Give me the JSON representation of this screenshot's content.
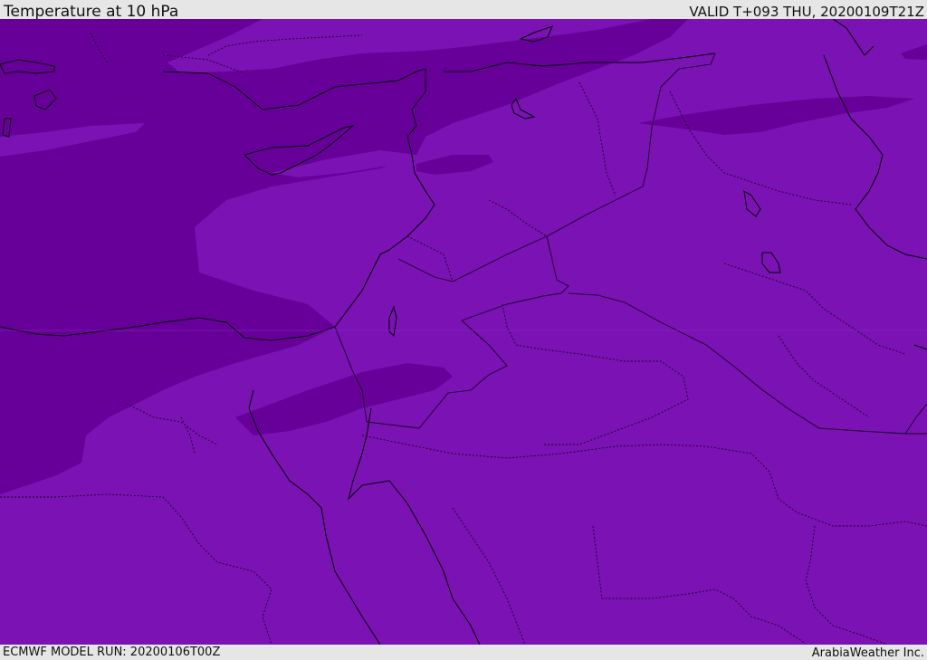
{
  "header": {
    "title": "Temperature at 10 hPa",
    "valid": "VALID T+093 THU, 20200109T21Z"
  },
  "footer": {
    "model_run": "ECMWF MODEL RUN: 20200106T00Z",
    "brand": "ArabiaWeather Inc."
  },
  "map": {
    "colors": {
      "warm_band": "#7a12b4",
      "cool_band": "#660099",
      "coastline": "#000000",
      "border": "#1a0026"
    }
  }
}
